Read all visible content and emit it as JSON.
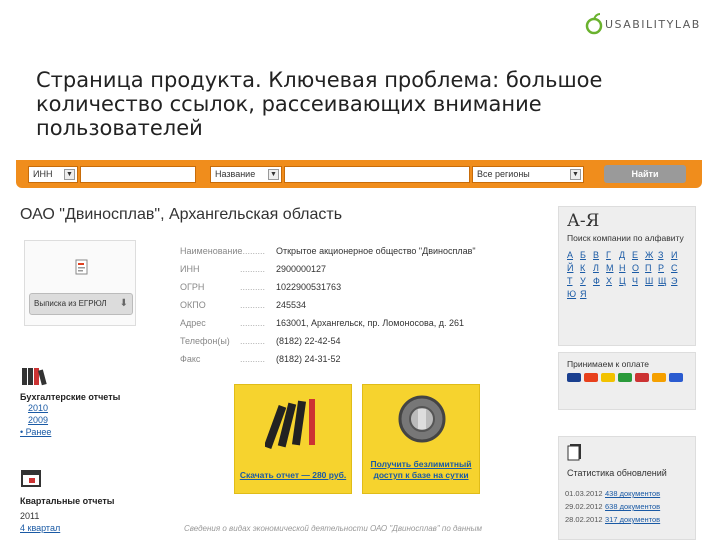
{
  "logo": {
    "text": "USABILITYLAB"
  },
  "slide": {
    "title": "Страница продукта. Ключевая проблема: большое количество ссылок, рассеивающих внимание пользователей"
  },
  "search": {
    "field1": "ИНН",
    "field2": "Название",
    "field3": "Все регионы",
    "button": "Найти"
  },
  "company": {
    "name": "ОАО \"Двиносплав\", Архангельская область"
  },
  "card": {
    "button": "Выписка из ЕГРЮЛ"
  },
  "info": [
    {
      "key": "Наименование",
      "value": "Открытое акционерное общество \"Двиносплав\""
    },
    {
      "key": "ИНН",
      "value": "2900000127"
    },
    {
      "key": "ОГРН",
      "value": "1022900531763"
    },
    {
      "key": "ОКПО",
      "value": "245534"
    },
    {
      "key": "Адрес",
      "value": "163001, Архангельск, пр. Ломоносова, д. 261"
    },
    {
      "key": "Телефон(ы)",
      "value": "(8182) 22-42-54"
    },
    {
      "key": "Факс",
      "value": "(8182) 24-31-52"
    }
  ],
  "accounting": {
    "title": "Бухгалтерские отчеты",
    "links": [
      "2010",
      "2009"
    ],
    "more": "• Ранее"
  },
  "quarterly": {
    "title": "Квартальные отчеты",
    "year": "2011",
    "link": "4 квартал"
  },
  "promo1": {
    "text": "Скачать отчет — 280 руб."
  },
  "promo2": {
    "text": "Получить безлимитный доступ к базе на сутки"
  },
  "side_az": {
    "title": "А-Я",
    "subtitle": "Поиск компании по алфавиту",
    "letters": [
      "А",
      "Б",
      "В",
      "Г",
      "Д",
      "Е",
      "Ж",
      "З",
      "И",
      "Й",
      "К",
      "Л",
      "М",
      "Н",
      "О",
      "П",
      "Р",
      "С",
      "Т",
      "У",
      "Ф",
      "Х",
      "Ц",
      "Ч",
      "Ш",
      "Щ",
      "Э",
      "Ю",
      "Я"
    ]
  },
  "side_pay": {
    "title": "Принимаем к оплате"
  },
  "side_stats": {
    "title": "Статистика обновлений",
    "rows": [
      {
        "date": "01.03.2012",
        "link": "438 документов"
      },
      {
        "date": "29.02.2012",
        "link": "638 документов"
      },
      {
        "date": "28.02.2012",
        "link": "317 документов"
      }
    ]
  },
  "footnote": "Сведения о видах экономической деятельности ОАО \"Двиносплав\" по данным"
}
